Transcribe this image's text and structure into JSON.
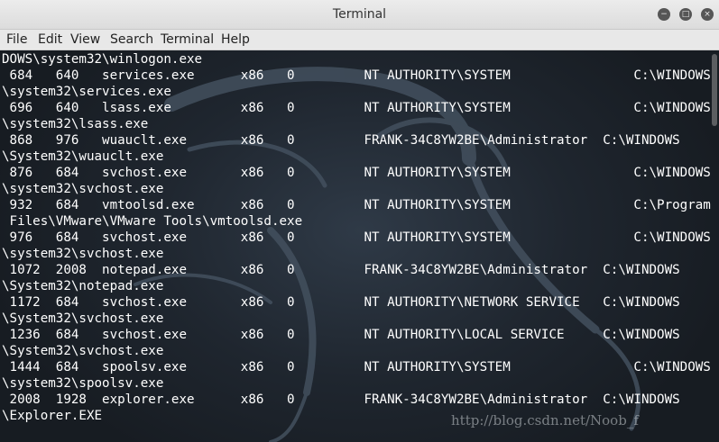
{
  "window": {
    "title": "Terminal",
    "controls": {
      "minimize": "−",
      "maximize": "□",
      "close": "×"
    }
  },
  "menu": {
    "items": [
      "File",
      "Edit",
      "View",
      "Search",
      "Terminal",
      "Help"
    ]
  },
  "terminal": {
    "lines": [
      "DOWS\\system32\\winlogon.exe",
      " 684   640   services.exe      x86   0         NT AUTHORITY\\SYSTEM                C:\\WINDOWS",
      "\\system32\\services.exe",
      " 696   640   lsass.exe         x86   0         NT AUTHORITY\\SYSTEM                C:\\WINDOWS",
      "\\system32\\lsass.exe",
      " 868   976   wuauclt.exe       x86   0         FRANK-34C8YW2BE\\Administrator  C:\\WINDOWS",
      "\\System32\\wuauclt.exe",
      " 876   684   svchost.exe       x86   0         NT AUTHORITY\\SYSTEM                C:\\WINDOWS",
      "\\system32\\svchost.exe",
      " 932   684   vmtoolsd.exe      x86   0         NT AUTHORITY\\SYSTEM                C:\\Program",
      " Files\\VMware\\VMware Tools\\vmtoolsd.exe",
      " 976   684   svchost.exe       x86   0         NT AUTHORITY\\SYSTEM                C:\\WINDOWS",
      "\\system32\\svchost.exe",
      " 1072  2008  notepad.exe       x86   0         FRANK-34C8YW2BE\\Administrator  C:\\WINDOWS",
      "\\System32\\notepad.exe",
      " 1172  684   svchost.exe       x86   0         NT AUTHORITY\\NETWORK SERVICE   C:\\WINDOWS",
      "\\System32\\svchost.exe",
      " 1236  684   svchost.exe       x86   0         NT AUTHORITY\\LOCAL SERVICE     C:\\WINDOWS",
      "\\System32\\svchost.exe",
      " 1444  684   spoolsv.exe       x86   0         NT AUTHORITY\\SYSTEM                C:\\WINDOWS",
      "\\system32\\spoolsv.exe",
      " 2008  1928  explorer.exe      x86   0         FRANK-34C8YW2BE\\Administrator  C:\\WINDOWS",
      "\\Explorer.EXE"
    ],
    "watermark": "http://blog.csdn.net/Noob_f"
  },
  "colors": {
    "terminal_bg": "#1f262f",
    "terminal_fg": "#ffffff",
    "titlebar_bg": "#e2e2e2",
    "menubar_bg": "#e8e8e8"
  }
}
